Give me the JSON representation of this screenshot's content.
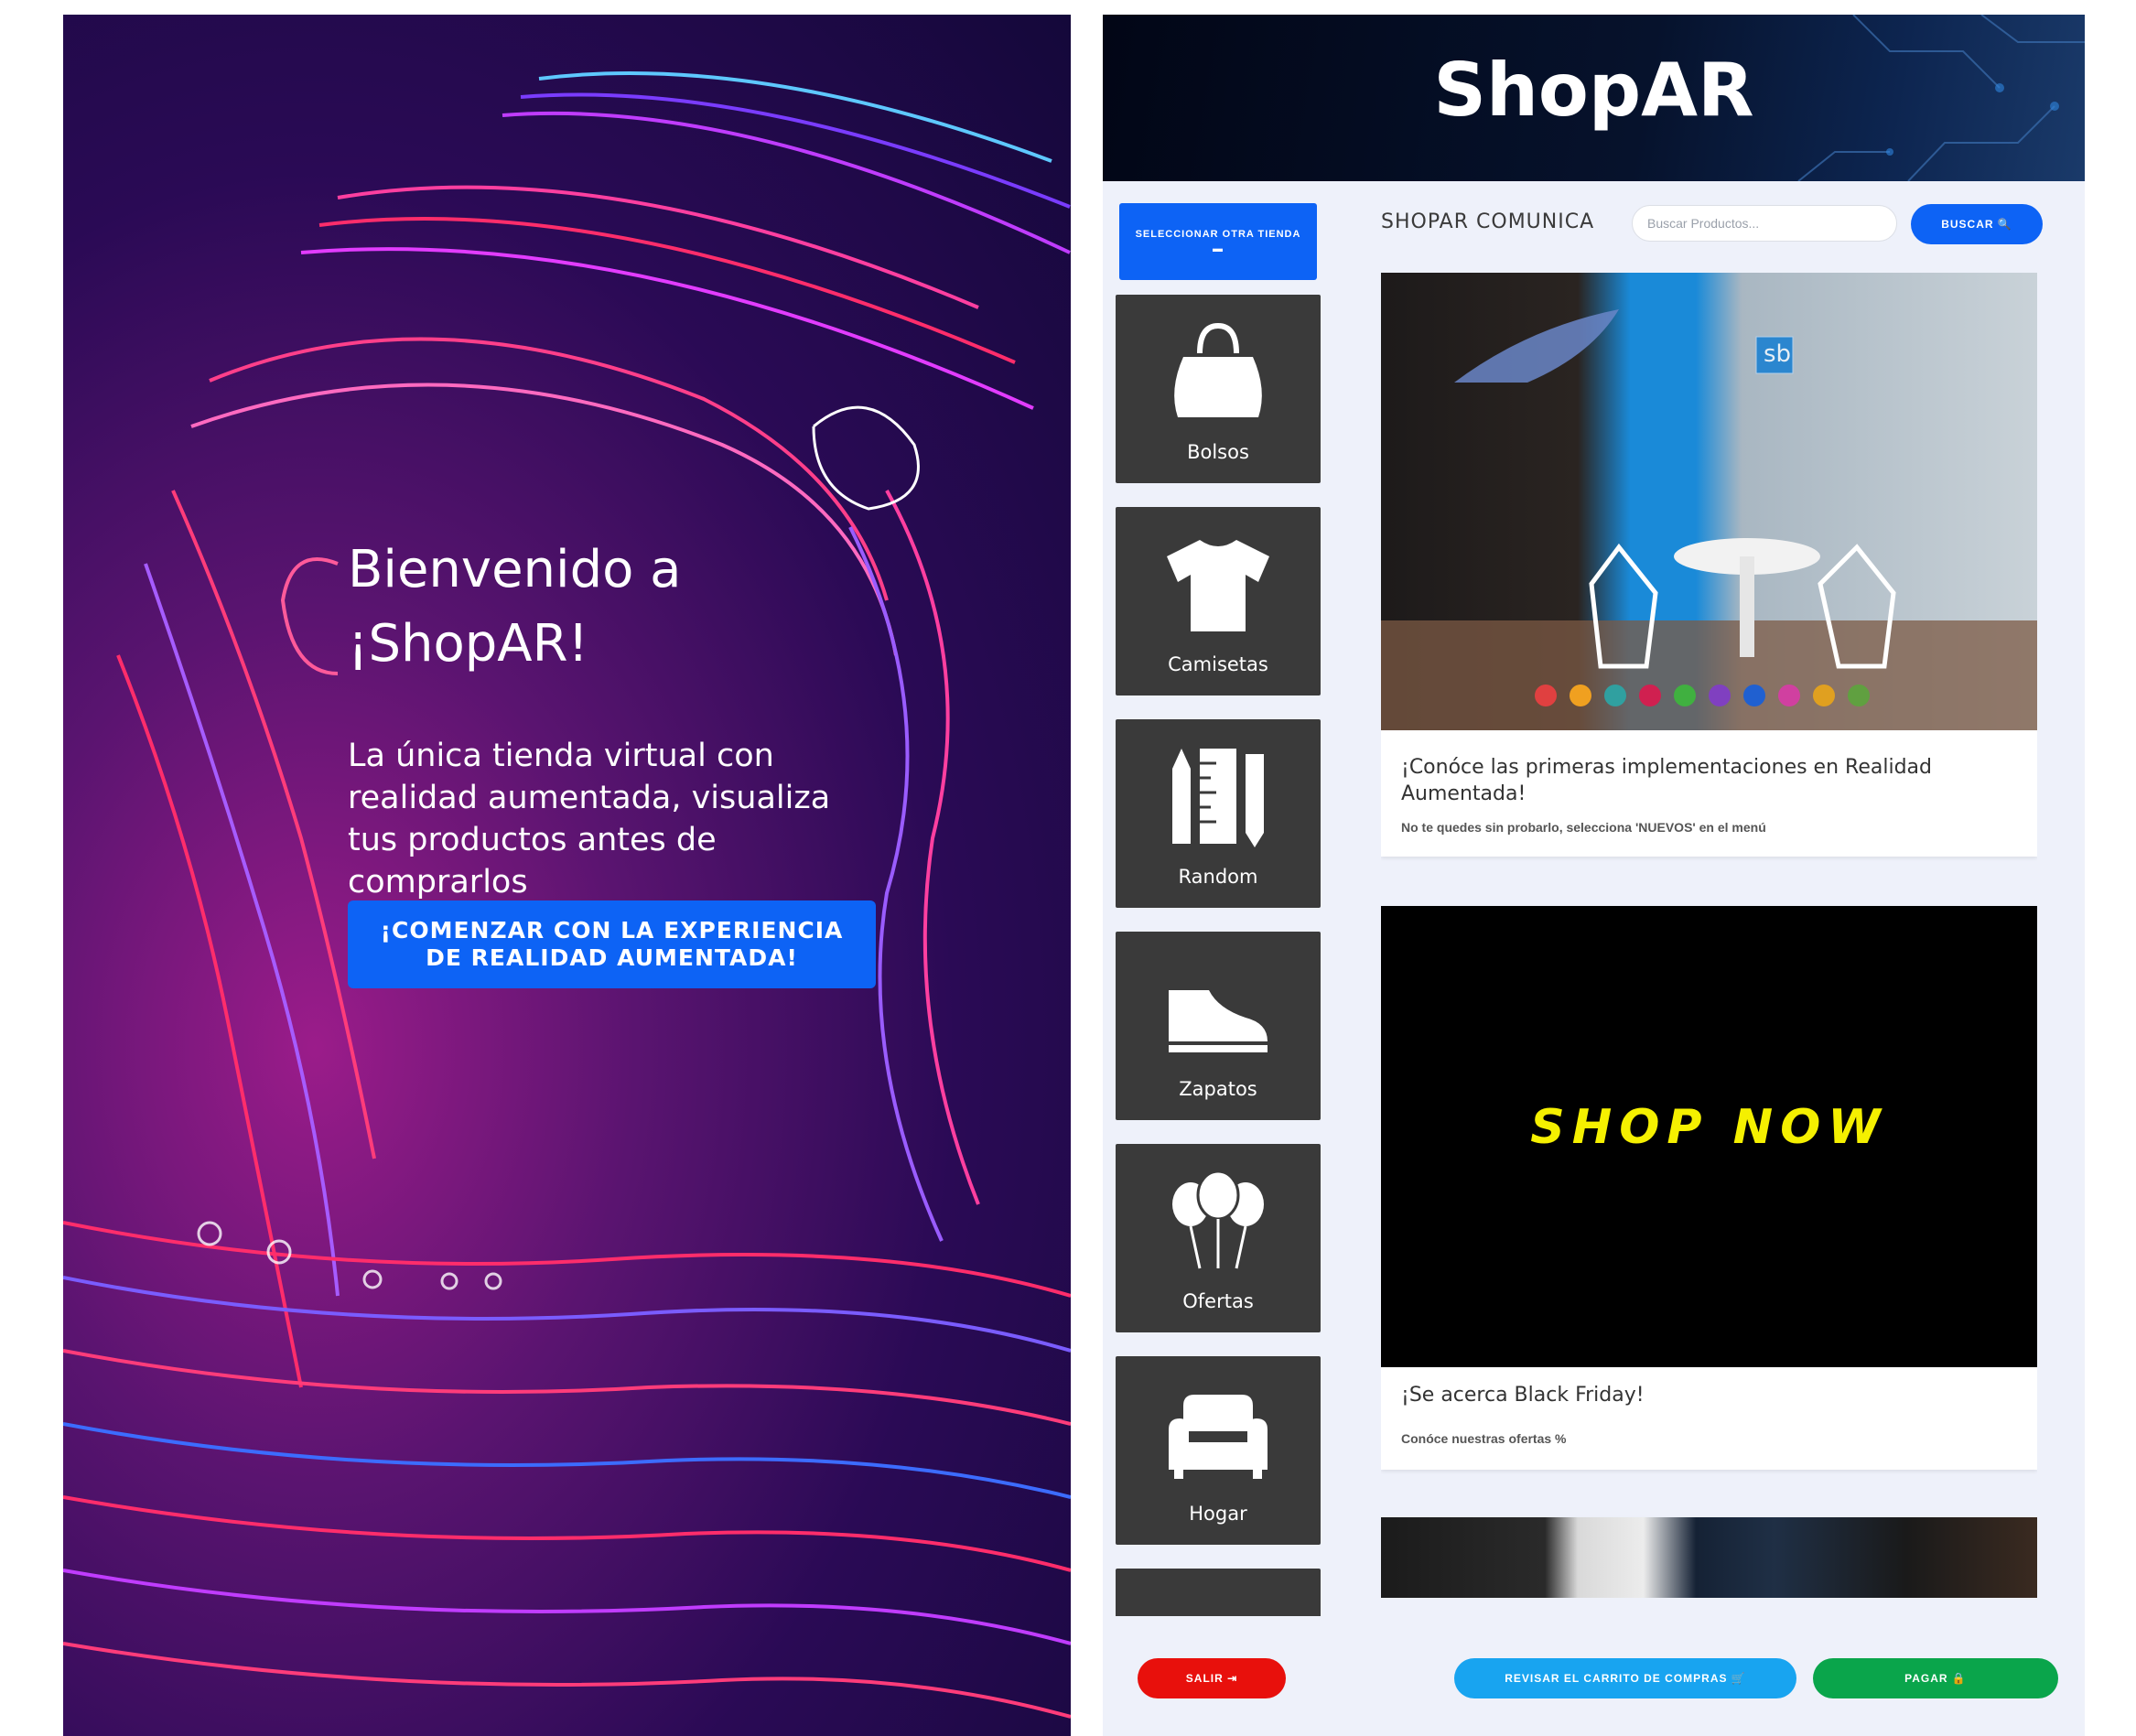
{
  "welcome": {
    "title": "Bienvenido a ¡ShopAR!",
    "text": "La única tienda virtual con realidad aumentada, visualiza tus productos antes de comprarlos",
    "cta_label": "¡COMENZAR CON LA EXPERIENCIA DE REALIDAD AUMENTADA!"
  },
  "app": {
    "title": "ShopAR",
    "select_store_label": "SELECCIONAR OTRA TIENDA ▬",
    "categories": [
      {
        "label": "Bolsos",
        "icon": "handbag-icon"
      },
      {
        "label": "Camisetas",
        "icon": "tshirt-icon"
      },
      {
        "label": "Random",
        "icon": "pencil-ruler-icon"
      },
      {
        "label": "Zapatos",
        "icon": "shoe-icon"
      },
      {
        "label": "Ofertas",
        "icon": "balloons-icon"
      },
      {
        "label": "Hogar",
        "icon": "sofa-icon"
      }
    ],
    "section_title": "SHOPAR COMUNICA",
    "search": {
      "placeholder": "Buscar Productos...",
      "button_label": "BUSCAR 🔍"
    },
    "posts": [
      {
        "title": "¡Conóce las primeras implementaciones en Realidad Aumentada!",
        "subtitle": "No te quedes sin probarlo, selecciona 'NUEVOS' en el menú",
        "image_label": "sb"
      },
      {
        "title": "¡Se acerca Black Friday!",
        "subtitle": "Conóce nuestras ofertas %",
        "image_text": "SHOP NOW"
      }
    ],
    "footer": {
      "exit_label": "SALIR ⇥",
      "cart_label": "REVISAR EL CARRITO DE COMPRAS 🛒",
      "pay_label": "PAGAR 🔒"
    },
    "colors": {
      "primary": "#0d63f5",
      "exit": "#e8100c",
      "cart": "#18a4f0",
      "pay": "#0aa54b"
    }
  }
}
